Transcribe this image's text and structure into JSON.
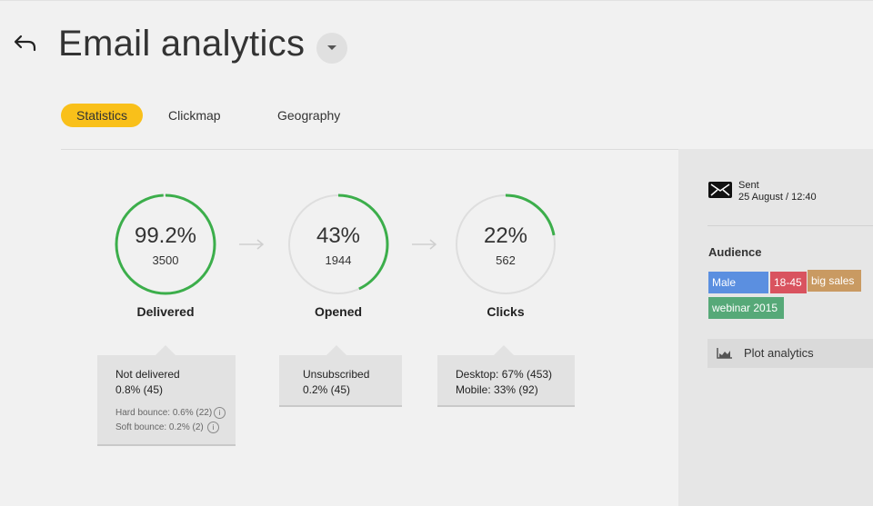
{
  "header": {
    "title": "Email analytics"
  },
  "tabs": [
    {
      "label": "Statistics",
      "active": true
    },
    {
      "label": "Clickmap",
      "active": false
    },
    {
      "label": "Geography",
      "active": false
    }
  ],
  "metrics": [
    {
      "percent_label": "99.2%",
      "count": "3500",
      "label": "Delivered",
      "fraction": 0.992
    },
    {
      "percent_label": "43%",
      "count": "1944",
      "label": "Opened",
      "fraction": 0.43
    },
    {
      "percent_label": "22%",
      "count": "562",
      "label": "Clicks",
      "fraction": 0.22
    }
  ],
  "cards": {
    "delivered": {
      "line1": "Not delivered",
      "line2": "0.8% (45)",
      "hard_bounce": "Hard bounce: 0.6% (22)",
      "soft_bounce": "Soft bounce: 0.2% (2)"
    },
    "opened": {
      "line1": "Unsubscribed",
      "line2": "0.2% (45)"
    },
    "clicks": {
      "line1": "Desktop: 67% (453)",
      "line2": "Mobile: 33% (92)"
    }
  },
  "sidebar": {
    "sent_label": "Sent",
    "sent_value": "25 August / 12:40",
    "audience_title": "Audience",
    "tags": [
      {
        "label": "Male",
        "color": "#5b8fe0"
      },
      {
        "label": "18-45",
        "color": "#d9535f"
      },
      {
        "label": "big sales",
        "color": "#c99a62"
      },
      {
        "label": "webinar 2015",
        "color": "#56a978"
      }
    ],
    "plot_button": "Plot analytics"
  },
  "colors": {
    "accent": "#f9c01a",
    "progress": "#3cae4b",
    "track": "#dedede"
  },
  "icons": {
    "back": "back-arrow-icon",
    "dropdown": "chevron-down-icon",
    "sent": "envelope-icon",
    "plot": "chart-icon",
    "info": "info-icon"
  }
}
